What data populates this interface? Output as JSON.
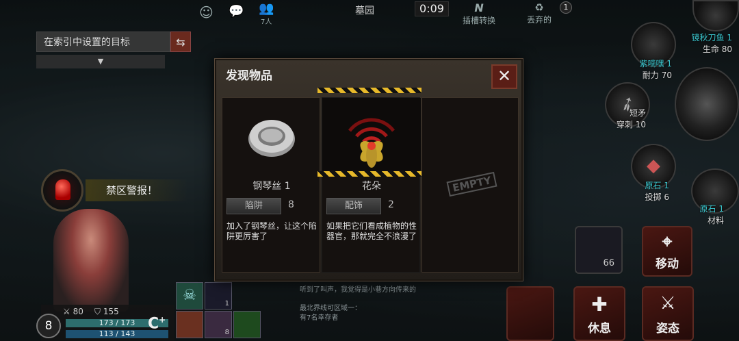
{
  "top_bar": {
    "people_count": "7人",
    "location": "墓园",
    "timer": "0:09",
    "plug_label": "插槽转换",
    "discard_label": "丢弃的",
    "discard_badge": "1"
  },
  "target": {
    "placeholder": "在索引中设置的目标",
    "dropdown_arrow": "▼"
  },
  "alert": {
    "text": "禁区警报！"
  },
  "dialog": {
    "title": "发现物品",
    "close_label": "✕",
    "items": [
      {
        "name": "钢琴丝 1",
        "tag": "陷阱",
        "count": "8",
        "description": "加入了钢琴丝，让这个陷阱更厉害了"
      },
      {
        "name": "花朵",
        "tag": "配饰",
        "count": "2",
        "description": "如果把它们看成植物的性器官，那就完全不浪漫了"
      }
    ],
    "empty_label": "EMPTY"
  },
  "player": {
    "level": "8",
    "attack": "80",
    "defense": "155",
    "hp": "173 / 173",
    "mp": "113 / 143",
    "skill_count": "1",
    "skill_count_2": "8"
  },
  "log": [
    "听到了叫声，我觉得是小巷方向传来的",
    "最北界线可区域一：",
    "有7名幸存者"
  ],
  "side_slots": [
    {
      "name": "镜秋刀鱼 1",
      "stat": "生命 80"
    },
    {
      "name": "紫嘀嘿 1",
      "stat": "耐力 70"
    },
    {
      "name": "短矛",
      "stat": "穿刺 10"
    },
    {
      "name": "原石 1",
      "stat": "投掷 6"
    },
    {
      "name": "原石 1",
      "stat": "材料"
    }
  ],
  "buttons": {
    "move": "移动",
    "rest": "休息",
    "stance": "姿态",
    "slot_count": "66"
  },
  "colors": {
    "hp_bar": "#2d6d6d",
    "mp_bar": "#1e5272",
    "hazard": "#e7b92a",
    "button_red": "#4a1712"
  }
}
